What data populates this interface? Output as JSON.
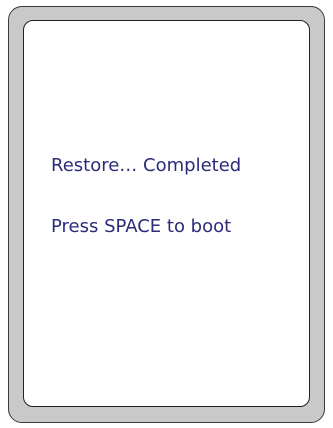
{
  "screen": {
    "status_line": "Restore… Completed",
    "prompt_line": "Press SPACE to boot"
  },
  "colors": {
    "text": "#2b2b7a",
    "bezel": "#c9c9c9",
    "screen_bg": "#ffffff"
  }
}
